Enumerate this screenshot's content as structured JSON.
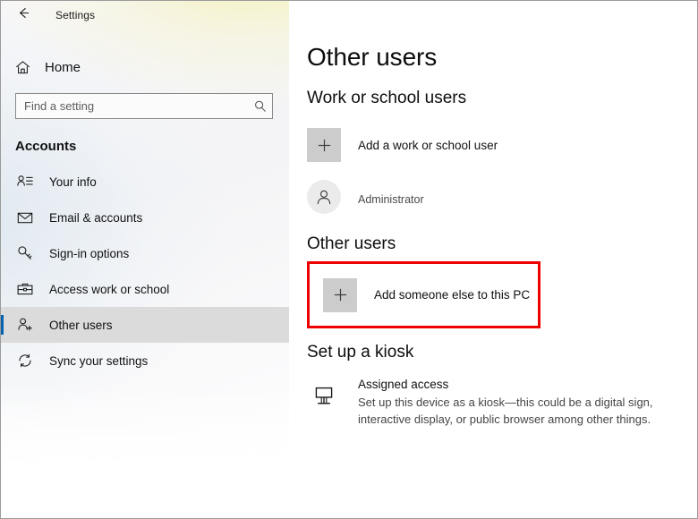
{
  "window": {
    "app_title": "Settings",
    "back_icon": "back-arrow-icon",
    "accent_color": "#0063b1",
    "highlight_color": "#ee0000"
  },
  "sidebar": {
    "home": {
      "label": "Home",
      "icon": "home-icon"
    },
    "search": {
      "placeholder": "Find a setting",
      "value": "",
      "icon": "search-icon"
    },
    "category": "Accounts",
    "items": [
      {
        "label": "Your info",
        "icon": "person-details-icon",
        "selected": false
      },
      {
        "label": "Email & accounts",
        "icon": "envelope-icon",
        "selected": false
      },
      {
        "label": "Sign-in options",
        "icon": "key-icon",
        "selected": false
      },
      {
        "label": "Access work or school",
        "icon": "briefcase-icon",
        "selected": false
      },
      {
        "label": "Other users",
        "icon": "person-add-icon",
        "selected": true
      },
      {
        "label": "Sync your settings",
        "icon": "sync-icon",
        "selected": false
      }
    ]
  },
  "main": {
    "page_title": "Other users",
    "work_school": {
      "heading": "Work or school users",
      "add_label": "Add a work or school user",
      "add_icon": "plus-icon",
      "account": {
        "name": "",
        "name_redacted": true,
        "role": "Administrator",
        "avatar_icon": "person-icon"
      }
    },
    "other_users": {
      "heading": "Other users",
      "add_label": "Add someone else to this PC",
      "add_icon": "plus-icon",
      "highlighted": true
    },
    "kiosk": {
      "heading": "Set up a kiosk",
      "title": "Assigned access",
      "description": "Set up this device as a kiosk—this could be a digital sign, interactive display, or public browser among other things.",
      "icon": "kiosk-display-icon"
    }
  }
}
